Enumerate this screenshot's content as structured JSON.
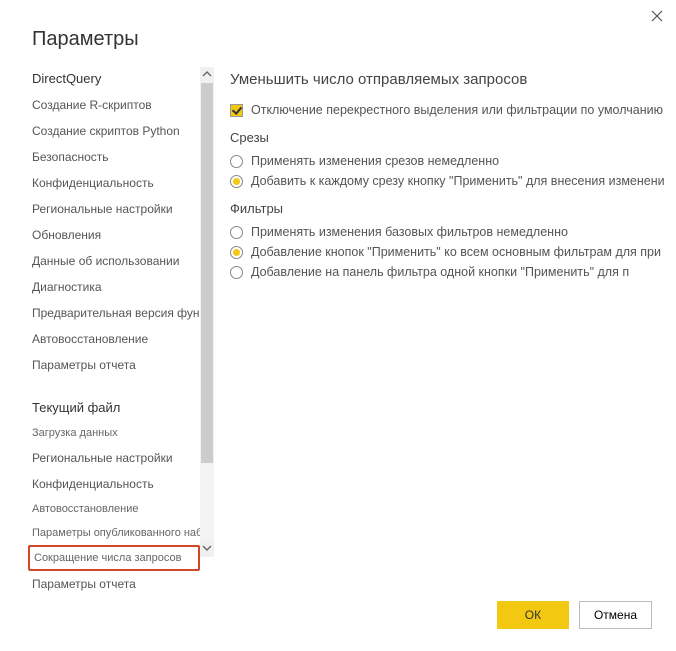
{
  "title": "Параметры",
  "sidebar": {
    "group1_header": "DirectQuery",
    "group1": [
      "Создание R-скриптов",
      "Создание скриптов Python",
      "Безопасность",
      "Конфиденциальность",
      "Региональные настройки",
      "Обновления",
      "Данные об использовании",
      "Диагностика",
      "Предварительная версия функций",
      "Автовосстановление",
      "Параметры отчета"
    ],
    "group2_header": "Текущий файл",
    "group2": [
      "Загрузка данных",
      "Региональные настройки",
      "Конфиденциальность",
      "Автовосстановление",
      "Параметры опубликованного набора данных",
      "Сокращение числа запросов",
      "Параметры отчета"
    ]
  },
  "content": {
    "section_title": "Уменьшить число отправляемых запросов",
    "checkbox_label": "Отключение перекрестного выделения или фильтрации по умолчанию",
    "slicers_header": "Срезы",
    "slicer_opt1": "Применять изменения срезов немедленно",
    "slicer_opt2": "Добавить к каждому срезу кнопку \"Применить\" для внесения изменени",
    "filters_header": "Фильтры",
    "filter_opt1": "Применять изменения базовых фильтров немедленно",
    "filter_opt2": "Добавление кнопок \"Применить\" ко всем основным фильтрам для при",
    "filter_opt3": "Добавление на панель фильтра одной кнопки \"Применить\" для п"
  },
  "buttons": {
    "ok": "ОК",
    "cancel": "Отмена"
  }
}
